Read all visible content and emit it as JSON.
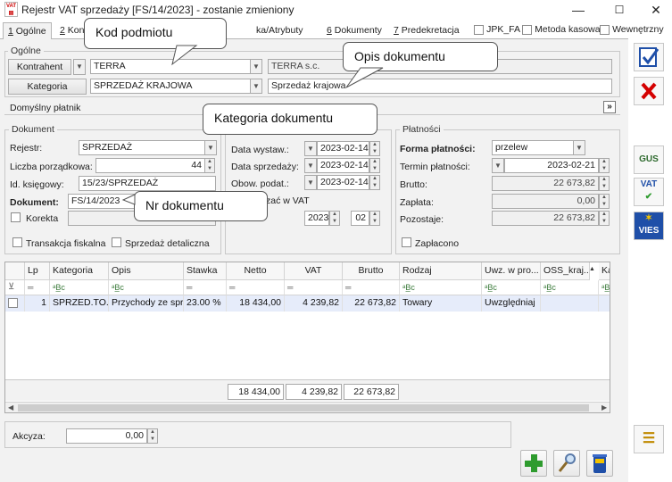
{
  "window": {
    "title": "Rejestr VAT sprzedaży [FS/14/2023] - zostanie zmieniony",
    "minimize": "—",
    "maximize": "☐",
    "close": "✕"
  },
  "tabs": [
    {
      "num": "1",
      "label": " Ogólne"
    },
    {
      "num": "2",
      "label": " Kont"
    },
    {
      "num": "",
      "label": "ka/Atrybuty"
    },
    {
      "num": "6",
      "label": " Dokumenty"
    },
    {
      "num": "7",
      "label": " Predekretacja"
    }
  ],
  "tab_checks": {
    "jpk_fa": "JPK_FA",
    "metoda_kasowa": "Metoda kasowa",
    "wewnetrzny": "Wewnętrzny"
  },
  "ogolne": {
    "legend": "Ogólne",
    "kontrahent_btn": "Kontrahent",
    "kontrahent_code": "TERRA",
    "kontrahent_name": "TERRA s.c.",
    "kategoria_btn": "Kategoria",
    "kategoria_code": "SPRZEDAŻ KRAJOWA",
    "kategoria_desc": "Sprzedaż krajowa"
  },
  "platnik": {
    "label": "Domyślny płatnik",
    "expand": "»"
  },
  "dokument": {
    "legend": "Dokument",
    "rejestr_label": "Rejestr:",
    "rejestr_value": "SPRZEDAŻ",
    "lp_label": "Liczba porządkowa:",
    "lp_value": "44",
    "idk_label": "Id. księgowy:",
    "idk_value": "15/23/SPRZEDAŻ",
    "dok_label": "Dokument:",
    "dok_value": "FS/14/2023",
    "korekta_label": "Korekta",
    "transakcja_label": "Transakcja fiskalna",
    "detaliczna_label": "Sprzedaż detaliczna"
  },
  "daty": {
    "wystaw_label": "Data wystaw.:",
    "wystaw_value": "2023-02-14",
    "sprzedazy_label": "Data sprzedaży:",
    "sprzedazy_value": "2023-02-14",
    "obow_label": "Obow. podat.:",
    "obow_value": "2023-02-14",
    "vat_label": "zać w VAT",
    "year_value": "2023",
    "month_value": "02"
  },
  "platnosci": {
    "legend": "Płatności",
    "forma_label": "Forma płatności:",
    "forma_value": "przelew",
    "termin_label": "Termin płatności:",
    "termin_value": "2023-02-21",
    "brutto_label": "Brutto:",
    "brutto_value": "22 673,82",
    "zaplata_label": "Zapłata:",
    "zaplata_value": "0,00",
    "pozostaje_label": "Pozostaje:",
    "pozostaje_value": "22 673,82",
    "zaplacono_label": "Zapłacono"
  },
  "table": {
    "headers": [
      "Lp",
      "Kategoria",
      "Opis",
      "Stawka",
      "Netto",
      "VAT",
      "Brutto",
      "Rodzaj",
      "Uwz. w pro...",
      "OSS_kraj...",
      "Ka"
    ],
    "filter": "ᵃB̲c",
    "filter_eq": "═",
    "filter_icon": "⊻",
    "row": {
      "lp": "1",
      "kategoria": "SPRZED.TO...",
      "opis": "Przychody ze spr...",
      "stawka": "23.00 %",
      "netto": "18 434,00",
      "vat": "4 239,82",
      "brutto": "22 673,82",
      "rodzaj": "Towary",
      "uwz": "Uwzględniaj"
    },
    "sum": {
      "netto": "18 434,00",
      "vat": "4 239,82",
      "brutto": "22 673,82"
    },
    "sort_arrow": "▲"
  },
  "akcyza": {
    "label": "Akcyza:",
    "value": "0,00"
  },
  "callouts": {
    "kod": "Kod podmiotu",
    "opis": "Opis dokumentu",
    "kategoria": "Kategoria dokumentu",
    "nr": "Nr  dokumentu"
  },
  "side": {
    "gus": "GUS",
    "vat": "VAT",
    "vies": "VIES"
  },
  "colors": {
    "accent": "#1f4fa8",
    "danger": "#d40000",
    "green": "#2e9b2e",
    "selection": "#e6ecfa"
  }
}
